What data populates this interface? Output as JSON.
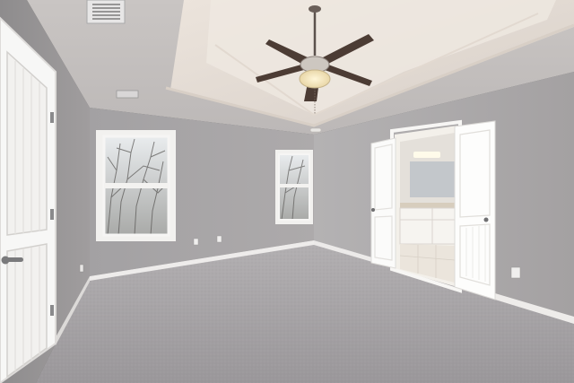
{
  "scene": {
    "subject": "empty-bedroom",
    "features": [
      "tray-ceiling",
      "ceiling-fan",
      "two-windows",
      "double-doors-to-bathroom",
      "carpet-floor",
      "closet-door"
    ]
  },
  "colors": {
    "wall": "#a6a3a4",
    "wall_light": "#b9b7b8",
    "ceiling": "#cfcac7",
    "tray": "#e3dbd4",
    "carpet": "#a9a6a8",
    "trim": "#f1efec",
    "door": "#ffffff"
  }
}
